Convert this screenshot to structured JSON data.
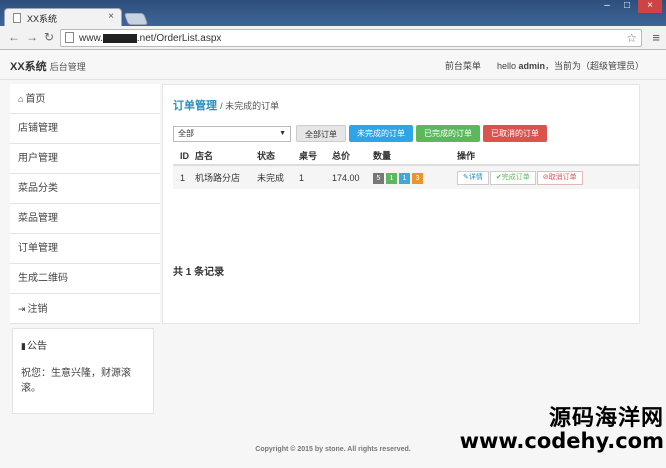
{
  "browser": {
    "tab_title": "XX系统",
    "url_prefix": "www.",
    "url_host_obscured": "",
    "url_suffix": ".net/OrderList.aspx"
  },
  "navbar": {
    "brand": "XX系统",
    "brand_sub": "后台管理",
    "front_menu": "前台菜单",
    "user_text": "hello",
    "user_name": "admin",
    "role_text": "，当前为（超级管理员）"
  },
  "sidebar": {
    "items": [
      {
        "icon": "home-icon",
        "label": "首页"
      },
      {
        "icon": "",
        "label": "店铺管理"
      },
      {
        "icon": "",
        "label": "用户管理"
      },
      {
        "icon": "",
        "label": "菜品分类"
      },
      {
        "icon": "",
        "label": "菜品管理"
      },
      {
        "icon": "",
        "label": "订单管理"
      },
      {
        "icon": "",
        "label": "生成二维码"
      },
      {
        "icon": "logout-icon",
        "label": "注销"
      }
    ],
    "notice_title": "公告",
    "notice_body": "祝您：生意兴隆，财源滚滚。"
  },
  "content": {
    "crumb_main": "订单管理",
    "crumb_sub": "未完成的订单",
    "filter_select": "全部",
    "buttons": {
      "all": "全部订单",
      "pending": "未完成的订单",
      "done": "已完成的订单",
      "cancelled": "已取消的订单"
    },
    "table": {
      "headers": [
        "ID",
        "店名",
        "状态",
        "桌号",
        "总价",
        "数量",
        "操作"
      ],
      "rows": [
        {
          "id": "1",
          "shop": "机场路分店",
          "status": "未完成",
          "table": "1",
          "total": "174.00",
          "qty": [
            "5",
            "1",
            "1",
            "3"
          ],
          "ops": {
            "detail": "详情",
            "finish": "完成订单",
            "cancel": "取消订单"
          }
        }
      ]
    },
    "total_prefix": "共",
    "total_count": "1",
    "total_suffix": "条记录"
  },
  "footer": "Copyright © 2015 by stone. All rights reserved.",
  "watermark": {
    "line1": "源码海洋网",
    "line2": "www.codehy.com"
  },
  "colors": {
    "primary": "#2fa4e7",
    "success": "#5cb85c",
    "danger": "#d9534f",
    "warning": "#e8952b"
  }
}
